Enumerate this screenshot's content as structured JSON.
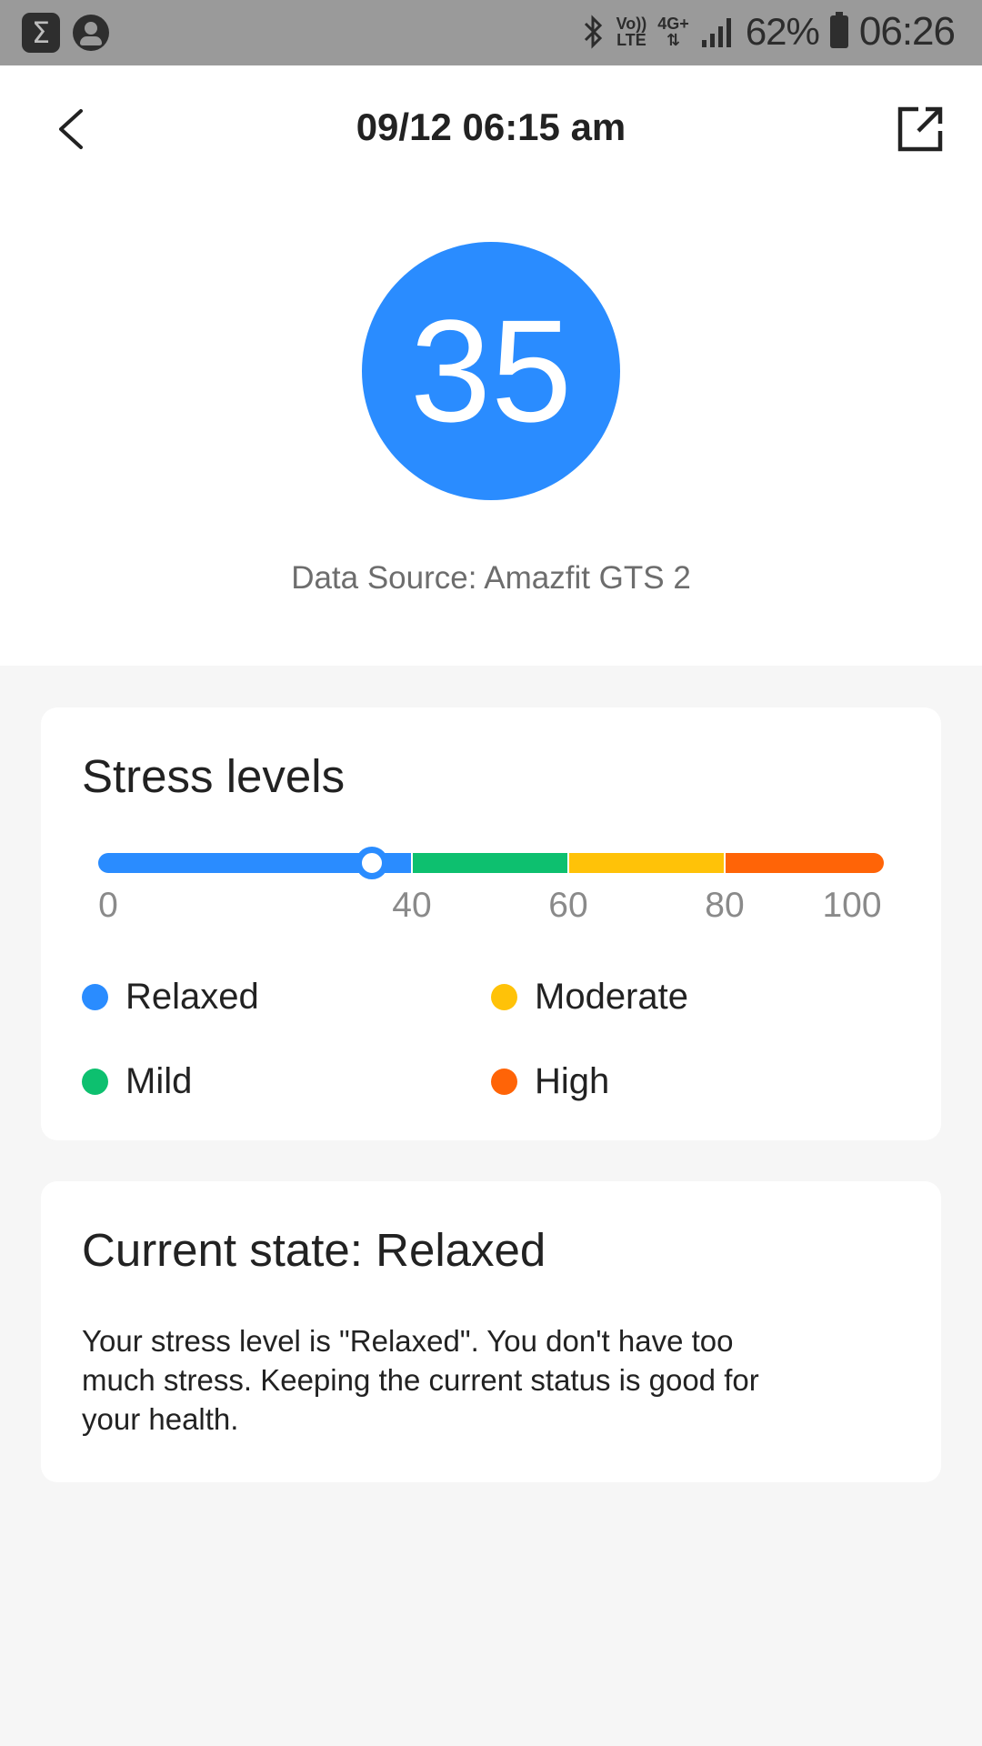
{
  "status_bar": {
    "app_icon_glyph": "Σ",
    "volte_top": "Vo))",
    "volte_bottom": "LTE",
    "network_type": "4G+",
    "battery_percent": "62%",
    "time": "06:26",
    "icons": [
      "sigma-app-icon",
      "account-icon",
      "bluetooth-icon",
      "volte-icon",
      "4g-plus-icon",
      "signal-icon",
      "battery-icon"
    ]
  },
  "header": {
    "title": "09/12 06:15 am",
    "icons": [
      "back-arrow-icon",
      "share-icon"
    ]
  },
  "score": {
    "value": "35",
    "data_source": "Data Source: Amazfit GTS 2"
  },
  "levels_card": {
    "title": "Stress levels",
    "current_value": 35,
    "scale": {
      "min": 0,
      "max": 100,
      "ticks": [
        "0",
        "40",
        "60",
        "80",
        "100"
      ]
    },
    "legend": {
      "relaxed": "Relaxed",
      "moderate": "Moderate",
      "mild": "Mild",
      "high": "High"
    },
    "colors": {
      "relaxed": "#2a8cff",
      "mild": "#0dc06f",
      "moderate": "#ffc208",
      "high": "#ff6407"
    }
  },
  "state_card": {
    "title": "Current state: Relaxed",
    "description": "Your stress level is \"Relaxed\". You don't have too much stress. Keeping the current status is good for your health."
  }
}
